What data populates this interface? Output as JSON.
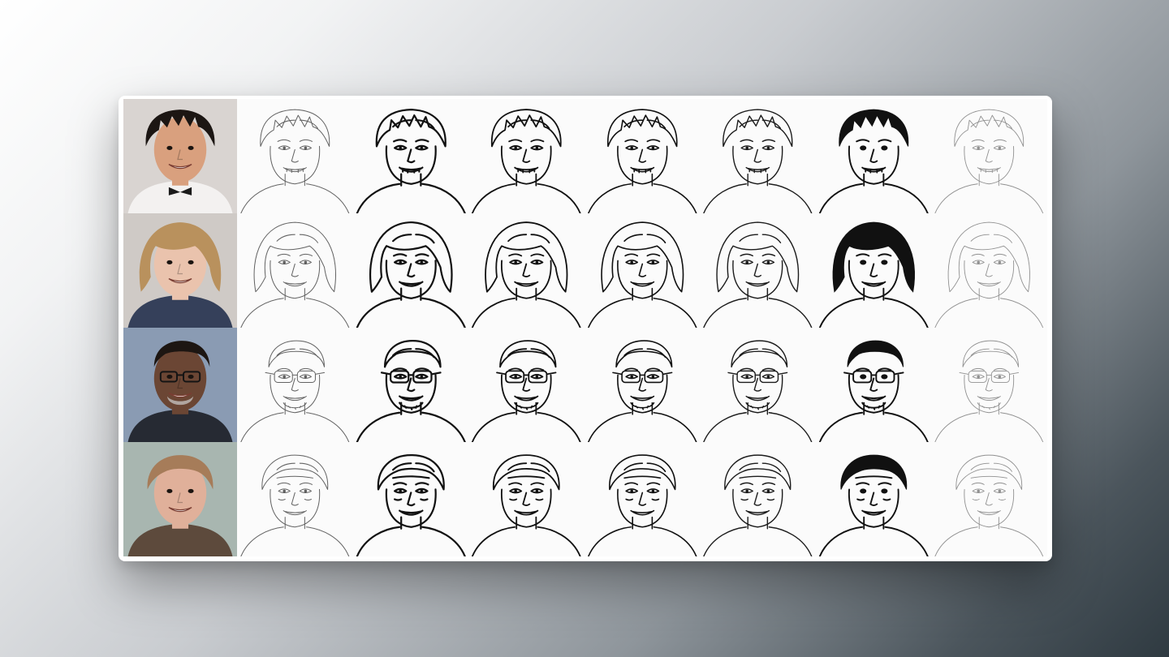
{
  "colors": {
    "ink": "#111111",
    "page": "#ffffff"
  },
  "rows": [
    {
      "subject": "boy",
      "photo": {
        "bg": "#d9d4d1",
        "skin": "#d9a07e",
        "hair": "#1c1613",
        "shirt": "#f3f1f0",
        "accent": "#1a1a1a"
      },
      "hair_style": "spiky"
    },
    {
      "subject": "girl",
      "photo": {
        "bg": "#cfcac6",
        "skin": "#eac3ad",
        "hair": "#b9915d",
        "shirt": "#35405a",
        "accent": "#8f6a3f"
      },
      "hair_style": "bob"
    },
    {
      "subject": "man-glasses",
      "photo": {
        "bg": "#8a9bb3",
        "skin": "#6b4634",
        "hair": "#1d1612",
        "shirt": "#262a33",
        "accent": "#cfcfcf"
      },
      "hair_style": "bald"
    },
    {
      "subject": "older-man",
      "photo": {
        "bg": "#a8b6b0",
        "skin": "#e0b09a",
        "hair": "#a67c59",
        "shirt": "#5d4a3c",
        "accent": "#8e8e8e"
      },
      "hair_style": "short"
    }
  ],
  "styles": [
    {
      "name": "style-1",
      "weight": 1.0,
      "opacity": 0.65,
      "fill": false,
      "dark_hair": false
    },
    {
      "name": "style-2",
      "weight": 2.2,
      "opacity": 1.0,
      "fill": false,
      "dark_hair": false
    },
    {
      "name": "style-3",
      "weight": 1.8,
      "opacity": 1.0,
      "fill": false,
      "dark_hair": false
    },
    {
      "name": "style-4",
      "weight": 1.6,
      "opacity": 1.0,
      "fill": false,
      "dark_hair": false
    },
    {
      "name": "style-5",
      "weight": 1.4,
      "opacity": 0.95,
      "fill": false,
      "dark_hair": false
    },
    {
      "name": "style-6",
      "weight": 1.9,
      "opacity": 1.0,
      "fill": true,
      "dark_hair": true
    },
    {
      "name": "style-7",
      "weight": 0.9,
      "opacity": 0.45,
      "fill": false,
      "dark_hair": false
    }
  ]
}
